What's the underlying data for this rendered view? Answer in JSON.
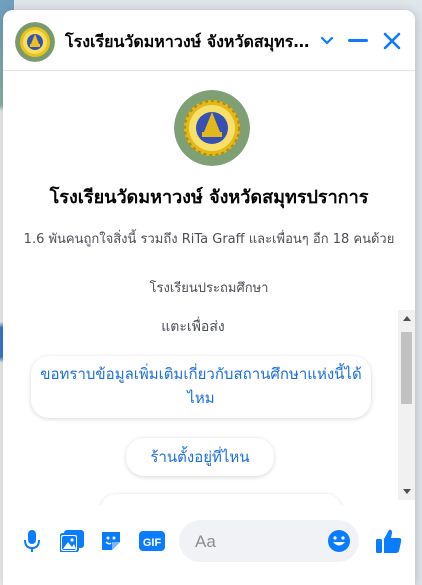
{
  "header": {
    "title": "โรงเรียนวัดมหาวงษ์ จังหวัดสมุทรปราการ",
    "accent_color": "#0a7cff"
  },
  "profile": {
    "name": "โรงเรียนวัดมหาวงษ์ จังหวัดสมุทรปราการ",
    "likes_text": "1.6 พันคนถูกใจสิ่งนี้ รวมถึง RiTa Graff และเพื่อนๆ อีก 18 คนด้วย",
    "category": "โรงเรียนประถมศึกษา"
  },
  "quick_replies": {
    "prompt": "แตะเพื่อส่ง",
    "items": [
      {
        "label": "ขอทราบข้อมูลเพิ่มเติมเกี่ยวกับสถานศึกษาแห่งนี้ได้ไหม"
      },
      {
        "label": "ร้านตั้งอยู่ที่ไหน"
      }
    ]
  },
  "composer": {
    "placeholder": "Aa",
    "icons": [
      "microphone-icon",
      "photo-icon",
      "sticker-icon",
      "gif-icon",
      "emoji-icon",
      "thumbs-up-icon"
    ]
  }
}
